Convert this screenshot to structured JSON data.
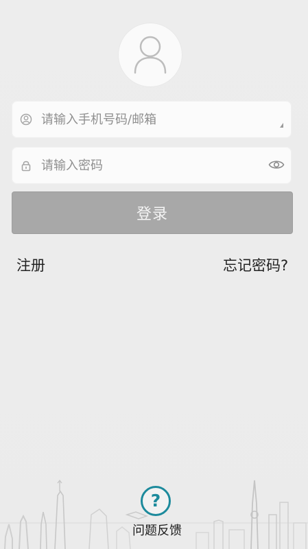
{
  "login_form": {
    "account_placeholder": "请输入手机号码/邮箱",
    "password_placeholder": "请输入密码",
    "submit_label": "登录"
  },
  "links": {
    "register": "注册",
    "forgot_password": "忘记密码?"
  },
  "footer": {
    "feedback_icon_symbol": "?",
    "feedback_label": "问题反馈"
  },
  "colors": {
    "background": "#ececec",
    "button_disabled": "#a8a8a8",
    "feedback_accent": "#1c8a9c"
  },
  "icons": {
    "avatar": "user-avatar-icon",
    "account": "user-icon",
    "password": "lock-icon",
    "visibility": "eye-icon",
    "dropdown": "dropdown-triangle-icon",
    "feedback": "question-circle-icon"
  }
}
